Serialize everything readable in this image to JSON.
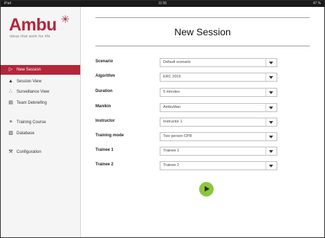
{
  "statusbar": {
    "left": "iPad",
    "time": "11:55",
    "right": "47 %"
  },
  "sidebar": {
    "logo_text": "Ambu",
    "logo_tagline": "ideas that work for life",
    "items": [
      {
        "label": "New Session",
        "icon": "play-circle-icon",
        "active": true
      },
      {
        "label": "Session View",
        "icon": "person-icon",
        "active": false
      },
      {
        "label": "Surveillance View",
        "icon": "group-icon",
        "active": false
      },
      {
        "label": "Team Debriefing",
        "icon": "clipboard-icon",
        "active": false
      },
      {
        "label": "Training Course",
        "icon": "list-icon",
        "active": false
      },
      {
        "label": "Database",
        "icon": "database-icon",
        "active": false
      },
      {
        "label": "Configuration",
        "icon": "wrench-icon",
        "active": false
      }
    ]
  },
  "main": {
    "title": "New Session",
    "fields": [
      {
        "label": "Scenario",
        "value": "Default scenario"
      },
      {
        "label": "Algorithm",
        "value": "ERC 2015"
      },
      {
        "label": "Duration",
        "value": "5 minutes"
      },
      {
        "label": "Manikin",
        "value": "AmbuMan"
      },
      {
        "label": "Instructor",
        "value": "Instructor 1"
      },
      {
        "label": "Training mode",
        "value": "Two person CPR"
      },
      {
        "label": "Trainee 1",
        "value": "Trainee 1"
      },
      {
        "label": "Trainee 2",
        "value": "Trainee 2"
      }
    ]
  },
  "colors": {
    "accent": "#b3263a",
    "play": "#8cc63f"
  }
}
